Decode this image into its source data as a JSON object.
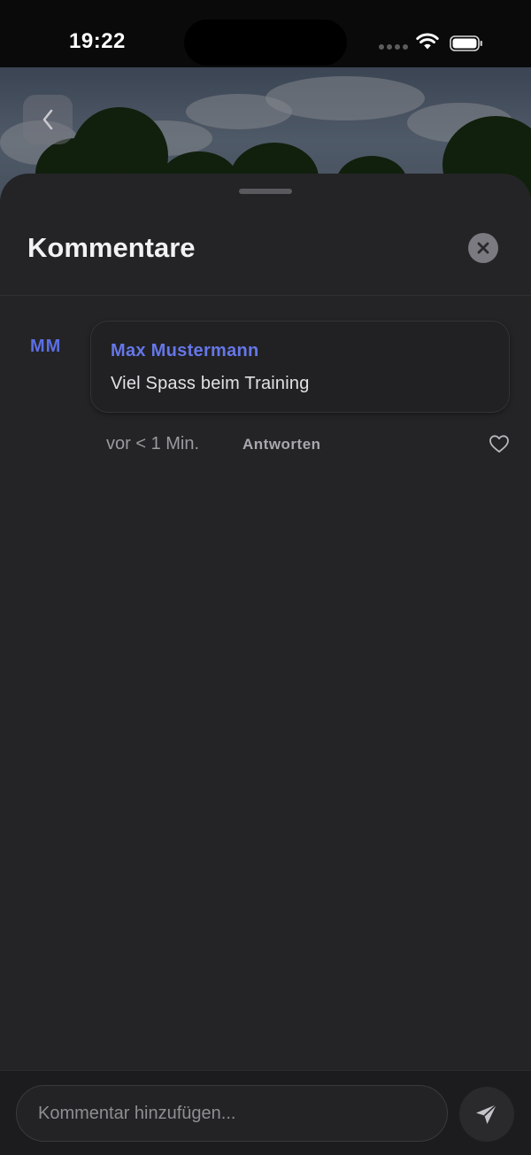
{
  "status_bar": {
    "time": "19:22"
  },
  "sheet": {
    "title": "Kommentare"
  },
  "comments": [
    {
      "initials": "MM",
      "author": "Max Mustermann",
      "text": "Viel Spass beim Training",
      "time": "vor < 1 Min.",
      "reply_label": "Antworten"
    }
  ],
  "composer": {
    "placeholder": "Kommentar hinzufügen...",
    "value": ""
  },
  "icons": {
    "back": "chevron-left-icon",
    "close": "close-icon",
    "like": "heart-icon",
    "send": "paper-plane-icon"
  },
  "colors": {
    "accent": "#5b6ee6",
    "sheet_background": "#242426"
  }
}
